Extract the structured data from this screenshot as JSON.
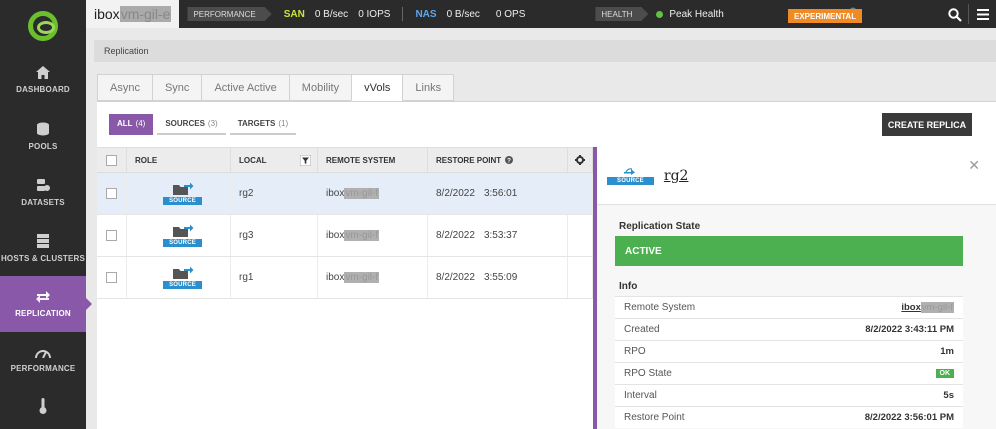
{
  "topbar": {
    "system_prefix": "ibox",
    "system_masked": "vm-gil-e",
    "performance_label": "PERFORMANCE",
    "san_label": "SAN",
    "san_bw": "0 B/sec",
    "san_iops": "0 IOPS",
    "nas_label": "NAS",
    "nas_bw": "0 B/sec",
    "nas_ops": "0 OPS",
    "health_label": "HEALTH",
    "health_value": "Peak Health",
    "experimental_label": "EXPERIMENTAL"
  },
  "sidebar": {
    "items": [
      {
        "label": "DASHBOARD",
        "icon": "home-icon"
      },
      {
        "label": "POOLS",
        "icon": "pools-icon"
      },
      {
        "label": "DATASETS",
        "icon": "datasets-icon"
      },
      {
        "label": "HOSTS & CLUSTERS",
        "icon": "hosts-icon"
      },
      {
        "label": "REPLICATION",
        "icon": "replication-icon"
      },
      {
        "label": "PERFORMANCE",
        "icon": "gauge-icon"
      }
    ]
  },
  "breadcrumb": "Replication",
  "tabs": [
    "Async",
    "Sync",
    "Active Active",
    "Mobility",
    "vVols",
    "Links"
  ],
  "filters": [
    {
      "label": "ALL",
      "count": "(4)"
    },
    {
      "label": "SOURCES",
      "count": "(3)"
    },
    {
      "label": "TARGETS",
      "count": "(1)"
    }
  ],
  "create_button": "CREATE REPLICA",
  "table": {
    "headers": [
      "ROLE",
      "LOCAL",
      "REMOTE SYSTEM",
      "RESTORE POINT"
    ],
    "rows": [
      {
        "role": "SOURCE",
        "local": "rg2",
        "remote_prefix": "ibox",
        "remote_masked": "vm-gil-f",
        "date": "8/2/2022",
        "time": "3:56:01"
      },
      {
        "role": "SOURCE",
        "local": "rg3",
        "remote_prefix": "ibox",
        "remote_masked": "vm-gil-f",
        "date": "8/2/2022",
        "time": "3:53:37"
      },
      {
        "role": "SOURCE",
        "local": "rg1",
        "remote_prefix": "ibox",
        "remote_masked": "vm-gil-f",
        "date": "8/2/2022",
        "time": "3:55:09"
      }
    ]
  },
  "detail": {
    "role": "SOURCE",
    "name": "rg2",
    "state_title": "Replication State",
    "state_value": "ACTIVE",
    "info_title": "Info",
    "info": {
      "remote_system_label": "Remote System",
      "remote_system_prefix": "ibox",
      "remote_system_masked": "vm-gil-f",
      "created_label": "Created",
      "created_value": "8/2/2022 3:43:11 PM",
      "rpo_label": "RPO",
      "rpo_value": "1m",
      "rpo_state_label": "RPO State",
      "rpo_state_value": "OK",
      "interval_label": "Interval",
      "interval_value": "5s",
      "restore_point_label": "Restore Point",
      "restore_point_value": "8/2/2022 3:56:01 PM"
    }
  },
  "colors": {
    "accent": "#8a58a8",
    "source_badge": "#2c8fcd",
    "active": "#4caf50",
    "experimental": "#f08a24"
  }
}
